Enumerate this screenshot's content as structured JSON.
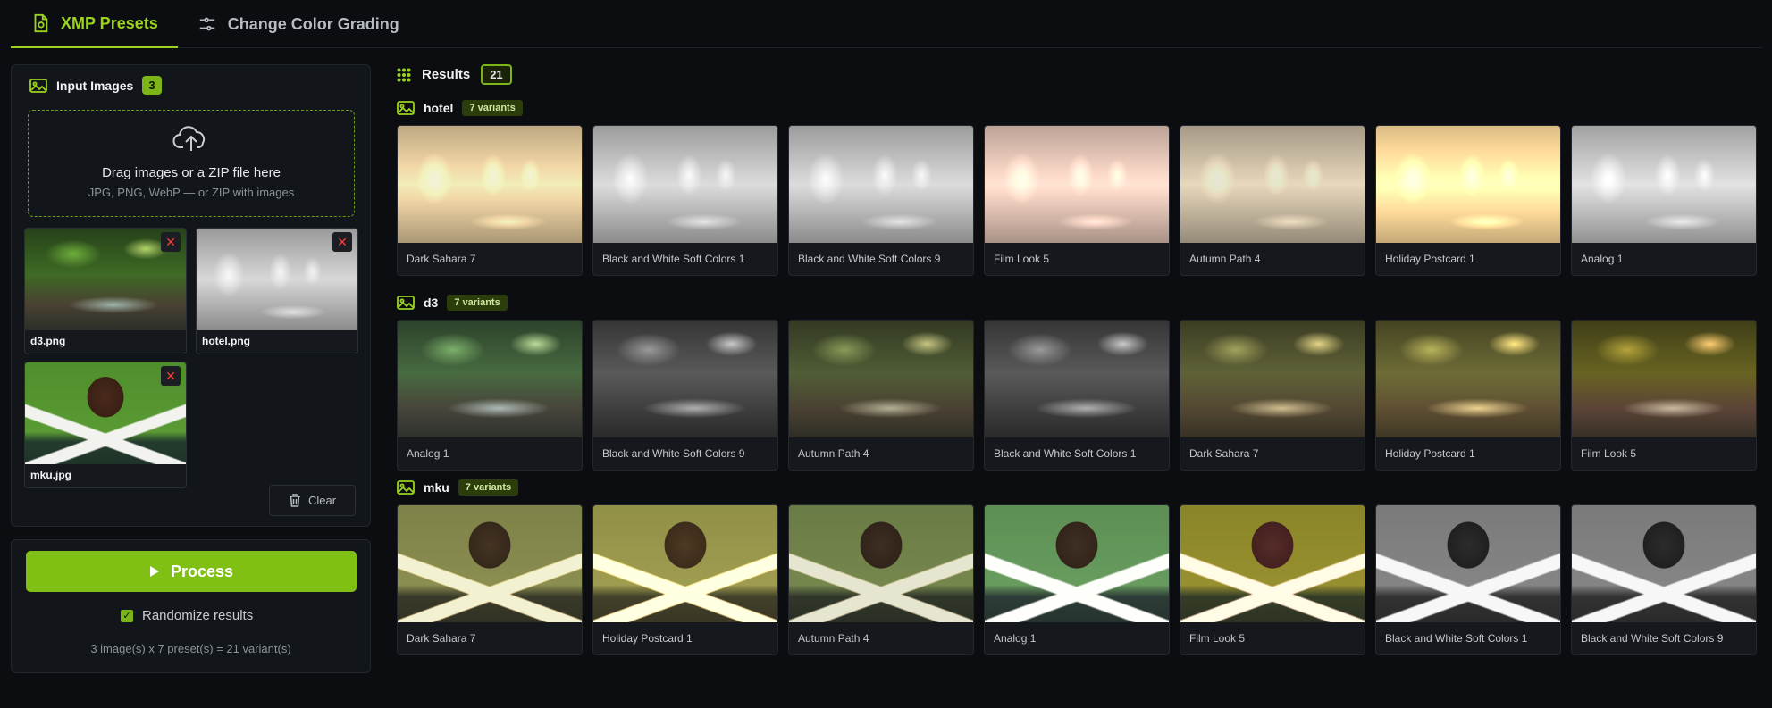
{
  "tabs": [
    {
      "label": "XMP Presets",
      "active": true
    },
    {
      "label": "Change Color Grading",
      "active": false
    }
  ],
  "input": {
    "title": "Input Images",
    "count": "3",
    "dropzone": {
      "title": "Drag images or a ZIP file here",
      "subtitle": "JPG, PNG, WebP — or ZIP with images"
    },
    "files": [
      {
        "name": "d3.png"
      },
      {
        "name": "hotel.png"
      },
      {
        "name": "mku.jpg"
      }
    ],
    "clear_label": "Clear"
  },
  "process": {
    "button_label": "Process",
    "randomize_label": "Randomize results",
    "randomize_checked": true,
    "summary": "3 image(s) x 7 preset(s) = 21 variant(s)"
  },
  "results": {
    "title": "Results",
    "count": "21",
    "groups": [
      {
        "name": "hotel",
        "badge": "7 variants",
        "variants": [
          "Dark Sahara 7",
          "Black and White Soft Colors 1",
          "Black and White Soft Colors 9",
          "Film Look 5",
          "Autumn Path 4",
          "Holiday Postcard 1",
          "Analog 1"
        ]
      },
      {
        "name": "d3",
        "badge": "7 variants",
        "variants": [
          "Analog 1",
          "Black and White Soft Colors 9",
          "Autumn Path 4",
          "Black and White Soft Colors 1",
          "Dark Sahara 7",
          "Holiday Postcard 1",
          "Film Look 5"
        ]
      },
      {
        "name": "mku",
        "badge": "7 variants",
        "variants": [
          "Dark Sahara 7",
          "Holiday Postcard 1",
          "Autumn Path 4",
          "Analog 1",
          "Film Look 5",
          "Black and White Soft Colors 1",
          "Black and White Soft Colors 9"
        ]
      }
    ]
  },
  "colors": {
    "accent": "#80bf14",
    "background": "#0b0d10",
    "panel": "#121519",
    "remove": "#ff3b3b"
  },
  "icons": {
    "tab_xmp": "file-preset-icon",
    "tab_color": "sliders-icon",
    "input": "image-icon",
    "upload": "cloud-upload-icon",
    "remove": "close-icon",
    "clear": "trash-icon",
    "process": "play-icon",
    "results": "grid-icon",
    "group": "image-icon"
  }
}
